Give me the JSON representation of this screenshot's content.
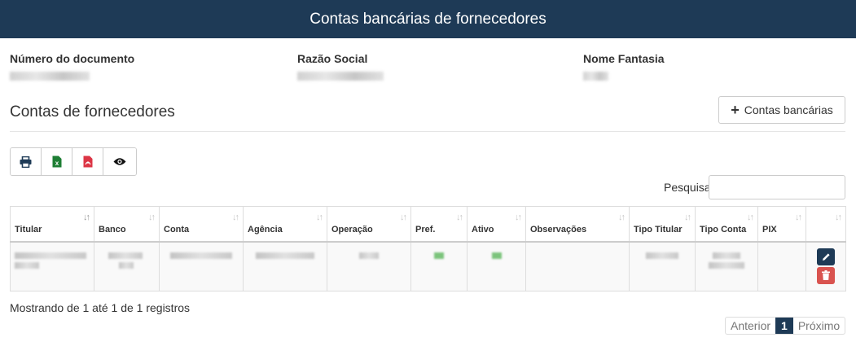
{
  "header": {
    "title": "Contas bancárias de fornecedores"
  },
  "fields": [
    {
      "label": "Número do documento"
    },
    {
      "label": "Razão Social"
    },
    {
      "label": "Nome Fantasia"
    }
  ],
  "section": {
    "title": "Contas de fornecedores",
    "add_button_label": "Contas bancárias"
  },
  "toolbar": {
    "buttons": [
      {
        "icon": "print-icon"
      },
      {
        "icon": "excel-icon"
      },
      {
        "icon": "pdf-icon"
      },
      {
        "icon": "eye-icon"
      }
    ]
  },
  "search": {
    "label": "Pesquisar",
    "value": ""
  },
  "table": {
    "columns": [
      "Titular",
      "Banco",
      "Conta",
      "Agência",
      "Operação",
      "Pref.",
      "Ativo",
      "Observações",
      "Tipo Titular",
      "Tipo Conta",
      "PIX",
      ""
    ],
    "row_actions": [
      "pencil-icon",
      "trash-icon"
    ]
  },
  "footer": {
    "info": "Mostrando de 1 até 1 de 1 registros",
    "pagination": {
      "prev": "Anterior",
      "current": "1",
      "next": "Próximo"
    }
  },
  "colors": {
    "primary": "#1e3a56",
    "danger": "#d9534f",
    "excel": "#1e7e34",
    "pdf": "#dc3545"
  }
}
